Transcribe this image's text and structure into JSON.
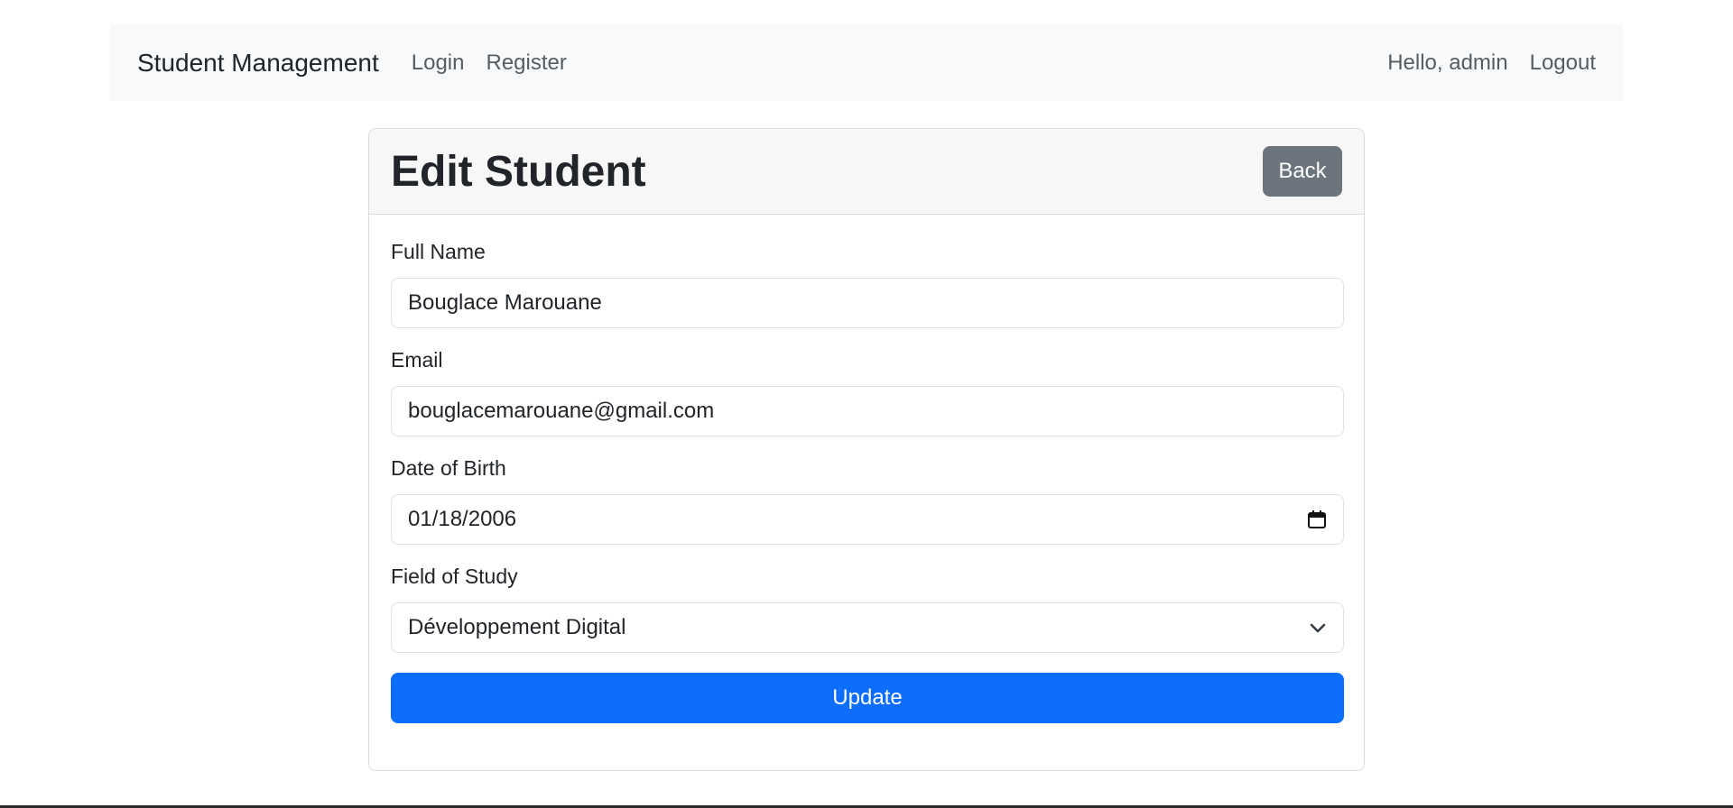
{
  "navbar": {
    "brand": "Student Management",
    "links": [
      "Login",
      "Register"
    ],
    "greeting": "Hello, admin",
    "logout": "Logout"
  },
  "card": {
    "title": "Edit Student",
    "back_label": "Back"
  },
  "form": {
    "full_name": {
      "label": "Full Name",
      "value": "Bouglace Marouane"
    },
    "email": {
      "label": "Email",
      "value": "bouglacemarouane@gmail.com"
    },
    "dob": {
      "label": "Date of Birth",
      "value": "01/18/2006"
    },
    "field_of_study": {
      "label": "Field of Study",
      "selected": "Développement Digital"
    },
    "submit_label": "Update"
  },
  "icons": {
    "calendar": "calendar-icon",
    "dropdown": "chevron-down-icon"
  },
  "colors": {
    "primary": "#0d6efd",
    "secondary": "#6c757d",
    "navbar_bg": "#f8f9fa"
  }
}
